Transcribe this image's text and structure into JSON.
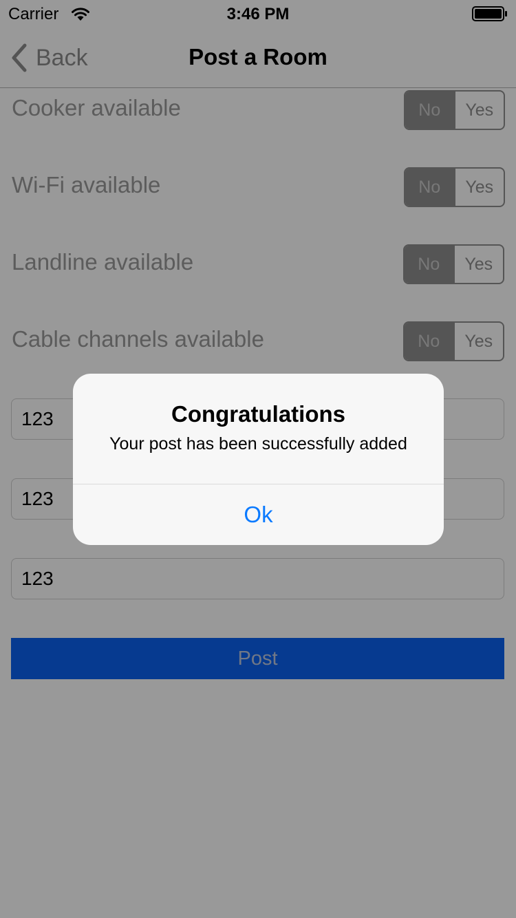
{
  "status_bar": {
    "carrier": "Carrier",
    "time": "3:46 PM",
    "icons": [
      "wifi-icon",
      "battery-icon"
    ]
  },
  "nav": {
    "back_label": "Back",
    "title": "Post a Room",
    "back_icon": "chevron-left-icon"
  },
  "rows": [
    {
      "label": "Cooker available",
      "options": [
        "No",
        "Yes"
      ],
      "selected": "No"
    },
    {
      "label": "Wi-Fi available",
      "options": [
        "No",
        "Yes"
      ],
      "selected": "No"
    },
    {
      "label": "Landline available",
      "options": [
        "No",
        "Yes"
      ],
      "selected": "No"
    },
    {
      "label": "Cable channels available",
      "options": [
        "No",
        "Yes"
      ],
      "selected": "No"
    }
  ],
  "fields": [
    {
      "value": "123"
    },
    {
      "value": "123"
    },
    {
      "value": "123"
    }
  ],
  "post_button": {
    "label": "Post"
  },
  "alert": {
    "title": "Congratulations",
    "message": "Your post has been successfully added",
    "button": "Ok"
  },
  "colors": {
    "accent": "#0a7aff",
    "post_button": "#0a61f0",
    "segment_gray": "#8e8e8e",
    "overlay": "rgba(0,0,0,0.40)"
  }
}
